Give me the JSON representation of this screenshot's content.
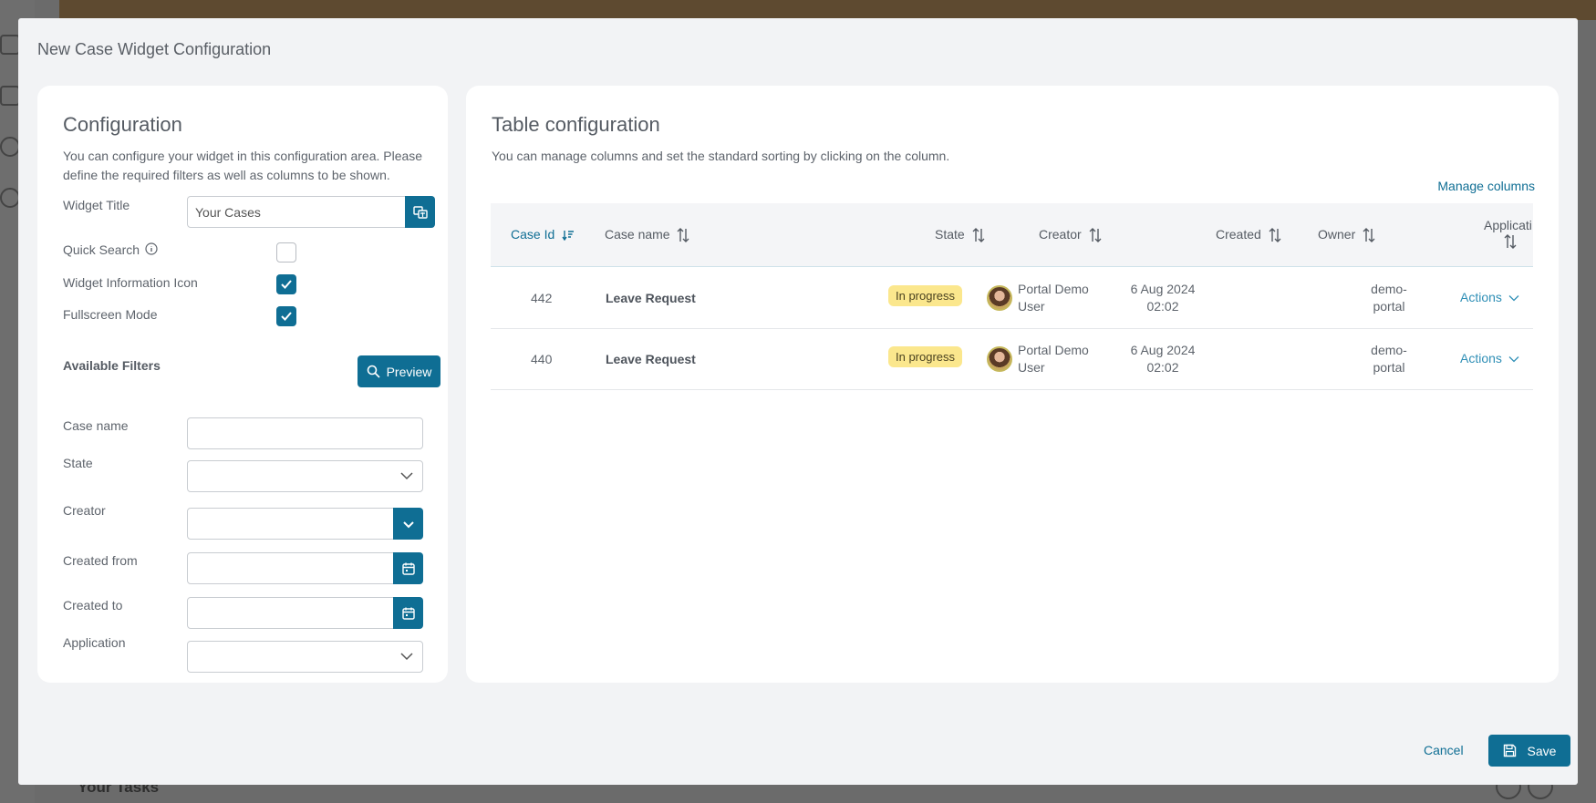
{
  "background": {
    "tasks_title": "Your Tasks"
  },
  "modal": {
    "title": "New Case Widget Configuration",
    "footer": {
      "cancel_label": "Cancel",
      "save_label": "Save"
    }
  },
  "config": {
    "heading": "Configuration",
    "description_line1": "You can configure your widget in this configuration area. Please",
    "description_line2": "define the required filters as well as columns to be shown.",
    "widget_title_label": "Widget Title",
    "widget_title_value": "Your Cases",
    "quick_search_label": "Quick Search",
    "quick_search_checked": false,
    "info_icon_label": "Widget Information Icon",
    "info_icon_checked": true,
    "fullscreen_label": "Fullscreen Mode",
    "fullscreen_checked": true,
    "filters_heading": "Available Filters",
    "preview_label": "Preview",
    "filters": {
      "case_name": "Case name",
      "state": "State",
      "creator": "Creator",
      "created_from": "Created from",
      "created_to": "Created to",
      "application": "Application"
    }
  },
  "table": {
    "heading": "Table configuration",
    "description": "You can manage columns and set the standard sorting by clicking on the column.",
    "manage_columns_label": "Manage columns",
    "columns": {
      "case_id": "Case Id",
      "case_name": "Case name",
      "state": "State",
      "creator": "Creator",
      "created": "Created",
      "owner": "Owner",
      "application": "Applicati"
    },
    "rows": [
      {
        "case_id": "442",
        "case_name": "Leave Request",
        "state": "In progress",
        "creator_line1": "Portal Demo",
        "creator_line2": "User",
        "created_line1": "6 Aug 2024",
        "created_line2": "02:02",
        "owner_line1": "demo-",
        "owner_line2": "portal",
        "actions": "Actions"
      },
      {
        "case_id": "440",
        "case_name": "Leave Request",
        "state": "In progress",
        "creator_line1": "Portal Demo",
        "creator_line2": "User",
        "created_line1": "6 Aug 2024",
        "created_line2": "02:02",
        "owner_line1": "demo-",
        "owner_line2": "portal",
        "actions": "Actions"
      }
    ]
  },
  "colors": {
    "primary": "#0f6e94",
    "badge": "#fbe78d",
    "link": "#2f8fb6"
  }
}
